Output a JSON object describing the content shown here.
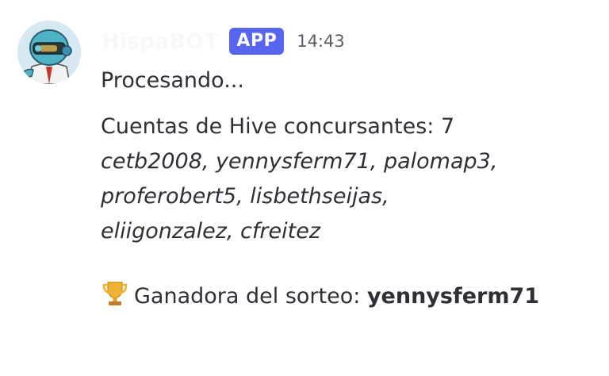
{
  "message": {
    "author": "HispaBOT",
    "app_tag": "APP",
    "timestamp": "14:43",
    "avatar_icon": "robot-avatar",
    "processing_text": "Procesando...",
    "accounts_label": "Cuentas de Hive concursantes: 7",
    "accounts_line_1": "cetb2008, yennysferm71, palomap3,",
    "accounts_line_2": "proferobert5, lisbethseijas,",
    "accounts_line_3": "eliigonzalez, cfreitez",
    "winner_icon": "trophy-icon",
    "winner_label": "Ganadora del sorteo: ",
    "winner_name": "yennysferm71"
  },
  "colors": {
    "app_tag_bg": "#5865f2",
    "text": "#2e3035",
    "timestamp": "#5c5e66",
    "trophy": "#f0b232"
  }
}
